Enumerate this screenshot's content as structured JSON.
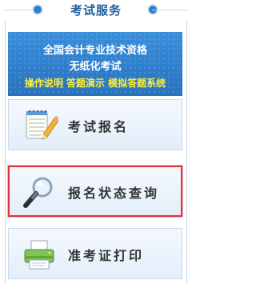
{
  "header": {
    "title": "考试服务"
  },
  "banner": {
    "line1": "全国会计专业技术资格",
    "line2": "无纸化考试",
    "line3": "操作说明 答题演示 模拟答题系统",
    "color_text": "#ffffff",
    "color_highlight": "#ffee33"
  },
  "menu": {
    "items": [
      {
        "label": "考试报名",
        "icon": "notepad-pencil-icon"
      },
      {
        "label": "报名状态查询",
        "icon": "magnifier-icon",
        "selected": true
      },
      {
        "label": "准考证打印",
        "icon": "printer-icon"
      }
    ]
  },
  "colors": {
    "accent": "#2d7fc8",
    "selection_border": "#e2313a"
  }
}
